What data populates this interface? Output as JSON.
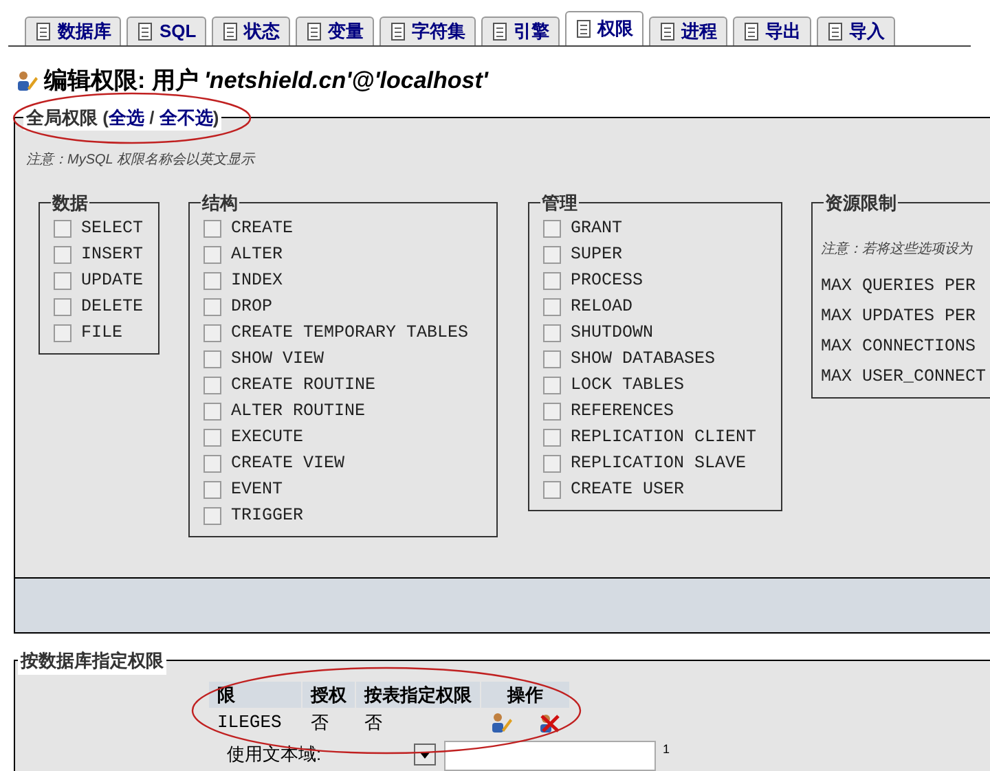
{
  "tabs": [
    {
      "label": "数据库",
      "selected": false
    },
    {
      "label": "SQL",
      "selected": false
    },
    {
      "label": "状态",
      "selected": false
    },
    {
      "label": "变量",
      "selected": false
    },
    {
      "label": "字符集",
      "selected": false
    },
    {
      "label": "引擎",
      "selected": false
    },
    {
      "label": "权限",
      "selected": true
    },
    {
      "label": "进程",
      "selected": false
    },
    {
      "label": "导出",
      "selected": false
    },
    {
      "label": "导入",
      "selected": false
    }
  ],
  "heading": {
    "prefix": "编辑权限: 用户 ",
    "user": "'netshield.cn'@'localhost'"
  },
  "global": {
    "legend": "全局权限",
    "open": "(",
    "select_all": "全选",
    "sep": "/",
    "deselect_all": "全不选",
    "close": ")",
    "note": "注意：MySQL 权限名称会以英文显示",
    "groups": [
      {
        "title": "数据",
        "items": [
          {
            "label": "SELECT",
            "checked": false
          },
          {
            "label": "INSERT",
            "checked": false
          },
          {
            "label": "UPDATE",
            "checked": false
          },
          {
            "label": "DELETE",
            "checked": false
          },
          {
            "label": "FILE",
            "checked": false
          }
        ]
      },
      {
        "title": "结构",
        "items": [
          {
            "label": "CREATE",
            "checked": false
          },
          {
            "label": "ALTER",
            "checked": false
          },
          {
            "label": "INDEX",
            "checked": false
          },
          {
            "label": "DROP",
            "checked": false
          },
          {
            "label": "CREATE TEMPORARY TABLES",
            "checked": false
          },
          {
            "label": "SHOW VIEW",
            "checked": false
          },
          {
            "label": "CREATE ROUTINE",
            "checked": false
          },
          {
            "label": "ALTER ROUTINE",
            "checked": false
          },
          {
            "label": "EXECUTE",
            "checked": false
          },
          {
            "label": "CREATE VIEW",
            "checked": false
          },
          {
            "label": "EVENT",
            "checked": false
          },
          {
            "label": "TRIGGER",
            "checked": false
          }
        ]
      },
      {
        "title": "管理",
        "items": [
          {
            "label": "GRANT",
            "checked": false
          },
          {
            "label": "SUPER",
            "checked": false
          },
          {
            "label": "PROCESS",
            "checked": false
          },
          {
            "label": "RELOAD",
            "checked": false
          },
          {
            "label": "SHUTDOWN",
            "checked": false
          },
          {
            "label": "SHOW DATABASES",
            "checked": false
          },
          {
            "label": "LOCK TABLES",
            "checked": false
          },
          {
            "label": "REFERENCES",
            "checked": false
          },
          {
            "label": "REPLICATION CLIENT",
            "checked": false
          },
          {
            "label": "REPLICATION SLAVE",
            "checked": false
          },
          {
            "label": "CREATE USER",
            "checked": false
          }
        ]
      }
    ],
    "resources": {
      "title": "资源限制",
      "note": "注意：若将这些选项设为",
      "items": [
        "MAX QUERIES PER",
        "MAX UPDATES PER",
        "MAX CONNECTIONS",
        "MAX USER_CONNECT"
      ]
    }
  },
  "db": {
    "legend": "按数据库指定权限",
    "columns": [
      "限",
      "授权",
      "按表指定权限",
      "操作"
    ],
    "rows": [
      {
        "cells": [
          "ILEGES",
          "否",
          "否"
        ]
      }
    ],
    "textfield_label": "使用文本域:",
    "count": "1"
  }
}
